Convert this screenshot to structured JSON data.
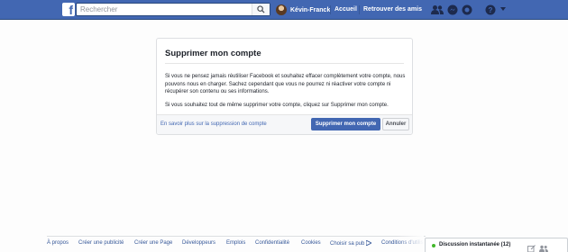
{
  "topbar": {
    "search_placeholder": "Rechercher",
    "profile_name": "Kévin-Franck",
    "home_label": "Accueil",
    "find_friends_label": "Retrouver des amis",
    "icons": [
      "facebook-logo",
      "search-icon",
      "friend-requests-icon",
      "messages-icon",
      "notifications-icon",
      "help-icon",
      "chevron-down-icon"
    ],
    "accent_color": "#4267b2"
  },
  "dialog": {
    "title": "Supprimer mon compte",
    "paragraph1": "Si vous ne pensez jamais réutiliser Facebook et souhaitez effacer complètement votre compte, nous pouvons nous en charger. Sachez cependant que vous ne pourrez ni réactiver votre compte ni récupérer son contenu ou ses informations.",
    "paragraph2": "Si vous souhaitez tout de même supprimer votre compte, cliquez sur Supprimer mon compte.",
    "learn_more_link": "En savoir plus sur la suppression de compte",
    "delete_button": "Supprimer mon compte",
    "cancel_button": "Annuler"
  },
  "footer": {
    "links": [
      "À propos",
      "Créer une publicité",
      "Créer une Page",
      "Développeurs",
      "Emplois",
      "Confidentialité",
      "Cookies",
      "Choisir sa pub",
      "Conditions d'utilis"
    ]
  },
  "chat": {
    "label": "Discussion instantanée (12)",
    "status_color": "#42b72a"
  }
}
